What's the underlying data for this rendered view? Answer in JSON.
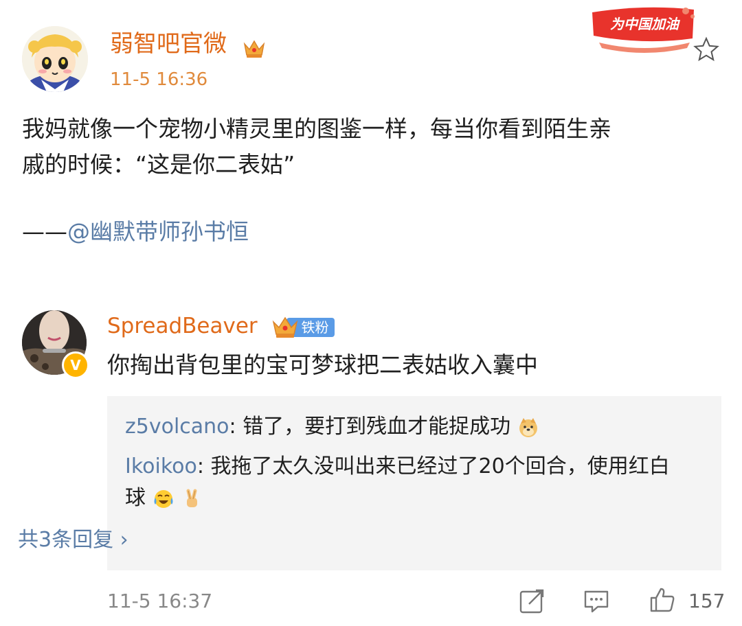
{
  "post": {
    "author": "弱智吧官微",
    "time": "11-5 16:36",
    "campaign_badge": "为中国加油",
    "body_line1": "我妈就像一个宠物小精灵里的图鉴一样，每当你看到陌生亲",
    "body_line2": "戚的时候：“这是你二表姑”",
    "quote_prefix": "——",
    "quote_mention": "@幽默带师孙书恒"
  },
  "comment": {
    "user": "SpreadBeaver",
    "fan_badge": "铁粉",
    "verified_mark": "V",
    "text": "你掏出背包里的宝可梦球把二表姑收入囊中",
    "replies": [
      {
        "user": "z5volcano",
        "sep": ": ",
        "text": "错了，要打到残血才能捉成功"
      },
      {
        "user": "Ikoikoo",
        "sep": ": ",
        "text_line1": "我拖了太久没叫出来已经过了20个回合，使用红白",
        "text_line2": "球"
      }
    ],
    "more_replies": "共3条回复 ›",
    "time": "11-5 16:37",
    "like_count": "157"
  },
  "icons": {
    "crown": "crown-icon",
    "star": "star-icon",
    "repost": "repost-icon",
    "comment": "comment-icon",
    "like": "thumbs-up-icon",
    "dog": "doge-emoji",
    "laugh_cry": "laugh-cry-emoji",
    "victory": "victory-hand-emoji"
  },
  "colors": {
    "author": "#e06a1a",
    "link": "#5a7ca6",
    "reply_bg": "#f4f4f4",
    "badge_red": "#e8332c"
  }
}
